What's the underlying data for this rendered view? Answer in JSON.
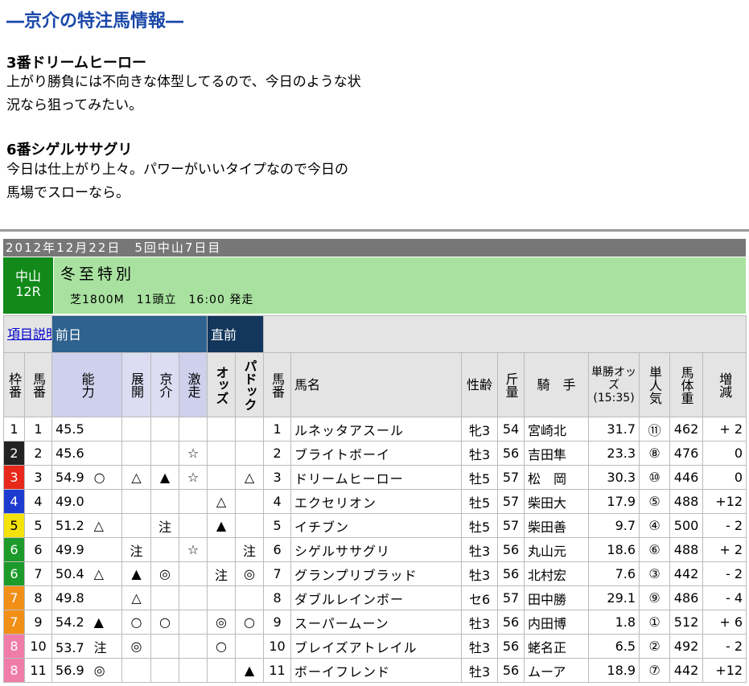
{
  "feature": {
    "title": "―京介の特注馬情報―",
    "picks": [
      {
        "heading": "3番ドリームヒーロー",
        "lines": [
          "上がり勝負には不向きな体型してるので、今日のような状",
          "況なら狙ってみたい。"
        ]
      },
      {
        "heading": "6番シゲルササグリ",
        "lines": [
          "今日は仕上がり上々。パワーがいいタイプなので今日の",
          "馬場でスローなら。"
        ]
      }
    ]
  },
  "race": {
    "date_line": "2012年12月22日　5回中山7日目",
    "venue": "中山",
    "race_no": "12R",
    "name": "冬至特別",
    "conditions": "芝1800M　11頭立　16:00 発走"
  },
  "table": {
    "item_link": "項目説明",
    "group_prev": "前日",
    "group_now": "直前",
    "headers": {
      "waku": "枠番",
      "umaban": "馬番",
      "nouryoku": "能力",
      "tenkai": "展開",
      "kyosuke": "京介",
      "gekiso": "激走",
      "odds": "オッズ",
      "paddock": "パドック",
      "umaban2": "馬番",
      "name": "馬名",
      "sexage": "性齢",
      "weight": "斤量",
      "jockey": "騎　手",
      "win_odds": "単勝オッズ(15:35)",
      "popularity": "単人気",
      "body": "馬体重",
      "change": "増減"
    },
    "rows": [
      {
        "waku": "1",
        "no": "1",
        "ability": "45.5",
        "tenkai": "",
        "kyosuke": "",
        "gekiso": "",
        "odds_m": "",
        "paddock_m": "",
        "name": "ルネッタアスール",
        "sexage": "牝3",
        "kin": "54",
        "jockey": "宮崎北",
        "odds": "31.7",
        "pop": "⑪",
        "body": "462",
        "change": "+ 2"
      },
      {
        "waku": "2",
        "no": "2",
        "ability": "45.6",
        "tenkai": "",
        "kyosuke": "",
        "gekiso": "☆",
        "odds_m": "",
        "paddock_m": "",
        "name": "ブライトボーイ",
        "sexage": "牡3",
        "kin": "56",
        "jockey": "吉田隼",
        "odds": "23.3",
        "pop": "⑧",
        "body": "476",
        "change": "0"
      },
      {
        "waku": "3",
        "no": "3",
        "ability": "54.9",
        "nouryoku_m": "○",
        "tenkai": "△",
        "kyosuke": "▲",
        "gekiso": "☆",
        "odds_m": "",
        "paddock_m": "△",
        "name": "ドリームヒーロー",
        "sexage": "牡5",
        "kin": "57",
        "jockey": "松　岡",
        "odds": "30.3",
        "pop": "⑩",
        "body": "446",
        "change": "0"
      },
      {
        "waku": "4",
        "no": "4",
        "ability": "49.0",
        "tenkai": "",
        "kyosuke": "",
        "gekiso": "",
        "odds_m": "△",
        "paddock_m": "",
        "name": "エクセリオン",
        "sexage": "牡5",
        "kin": "57",
        "jockey": "柴田大",
        "odds": "17.9",
        "pop": "⑤",
        "body": "488",
        "change": "+12"
      },
      {
        "waku": "5",
        "no": "5",
        "ability": "51.2",
        "nouryoku_m": "△",
        "tenkai": "",
        "kyosuke": "注",
        "gekiso": "",
        "odds_m": "▲",
        "paddock_m": "",
        "name": "イチブン",
        "sexage": "牡5",
        "kin": "57",
        "jockey": "柴田善",
        "odds": "9.7",
        "pop": "④",
        "body": "500",
        "change": "- 2"
      },
      {
        "waku": "6",
        "no": "6",
        "ability": "49.9",
        "tenkai": "注",
        "kyosuke": "",
        "gekiso": "☆",
        "odds_m": "",
        "paddock_m": "注",
        "name": "シゲルササグリ",
        "sexage": "牡3",
        "kin": "56",
        "jockey": "丸山元",
        "odds": "18.6",
        "pop": "⑥",
        "body": "488",
        "change": "+ 2"
      },
      {
        "waku": "6",
        "no": "7",
        "ability": "50.4",
        "nouryoku_m": "△",
        "tenkai": "▲",
        "kyosuke": "◎",
        "gekiso": "",
        "odds_m": "注",
        "paddock_m": "◎",
        "name": "グランプリブラッド",
        "sexage": "牡3",
        "kin": "56",
        "jockey": "北村宏",
        "odds": "7.6",
        "pop": "③",
        "body": "442",
        "change": "- 2"
      },
      {
        "waku": "7",
        "no": "8",
        "ability": "49.8",
        "tenkai": "△",
        "kyosuke": "",
        "gekiso": "",
        "odds_m": "",
        "paddock_m": "",
        "name": "ダブルレインボー",
        "sexage": "セ6",
        "kin": "57",
        "jockey": "田中勝",
        "odds": "29.1",
        "pop": "⑨",
        "body": "486",
        "change": "- 4"
      },
      {
        "waku": "7",
        "no": "9",
        "ability": "54.2",
        "nouryoku_m": "▲",
        "tenkai": "○",
        "kyosuke": "○",
        "gekiso": "",
        "odds_m": "◎",
        "paddock_m": "○",
        "name": "スーパームーン",
        "sexage": "牡3",
        "kin": "56",
        "jockey": "内田博",
        "odds": "1.8",
        "pop": "①",
        "body": "512",
        "change": "+ 6"
      },
      {
        "waku": "8",
        "no": "10",
        "ability": "53.7",
        "nouryoku_m": "注",
        "tenkai": "◎",
        "kyosuke": "",
        "gekiso": "",
        "odds_m": "○",
        "paddock_m": "",
        "name": "ブレイズアトレイル",
        "sexage": "牡3",
        "kin": "56",
        "jockey": "蛯名正",
        "odds": "6.5",
        "pop": "②",
        "body": "492",
        "change": "- 2"
      },
      {
        "waku": "8",
        "no": "11",
        "ability": "56.9",
        "nouryoku_m": "◎",
        "tenkai": "",
        "kyosuke": "",
        "gekiso": "",
        "odds_m": "",
        "paddock_m": "▲",
        "name": "ボーイフレンド",
        "sexage": "牡3",
        "kin": "56",
        "jockey": "ムーア",
        "odds": "18.9",
        "pop": "⑦",
        "body": "442",
        "change": "+12"
      }
    ]
  },
  "colors": {
    "title_blue": "#1a47a8",
    "waku": {
      "1": "#ffffff",
      "2": "#222222",
      "3": "#e8281a",
      "4": "#1d3bd0",
      "5": "#f4e20c",
      "6": "#1c9a2a",
      "7": "#f28f16",
      "8": "#f07ca8"
    },
    "waku_text": {
      "1": "#000000",
      "2": "#ffffff",
      "3": "#ffffff",
      "4": "#ffffff",
      "5": "#000000",
      "6": "#ffffff",
      "7": "#ffffff",
      "8": "#ffffff"
    }
  }
}
